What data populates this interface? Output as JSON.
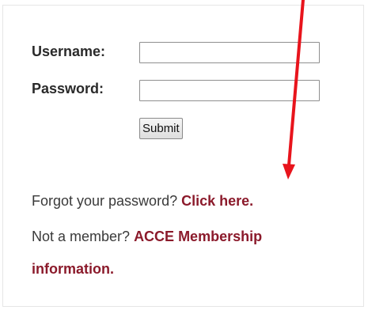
{
  "login_form": {
    "username_label": "Username:",
    "password_label": "Password:",
    "username_value": "",
    "password_value": "",
    "submit_label": "Submit"
  },
  "help_links": {
    "forgot_text": "Forgot your password? ",
    "forgot_link": "Click here.",
    "member_text": "Not a member? ",
    "member_link_part1": "ACCE Membership",
    "member_link_part2": "information."
  },
  "annotation": {
    "arrow_color": "#e8141c",
    "arrow_icon": "red-arrow-down-icon"
  }
}
